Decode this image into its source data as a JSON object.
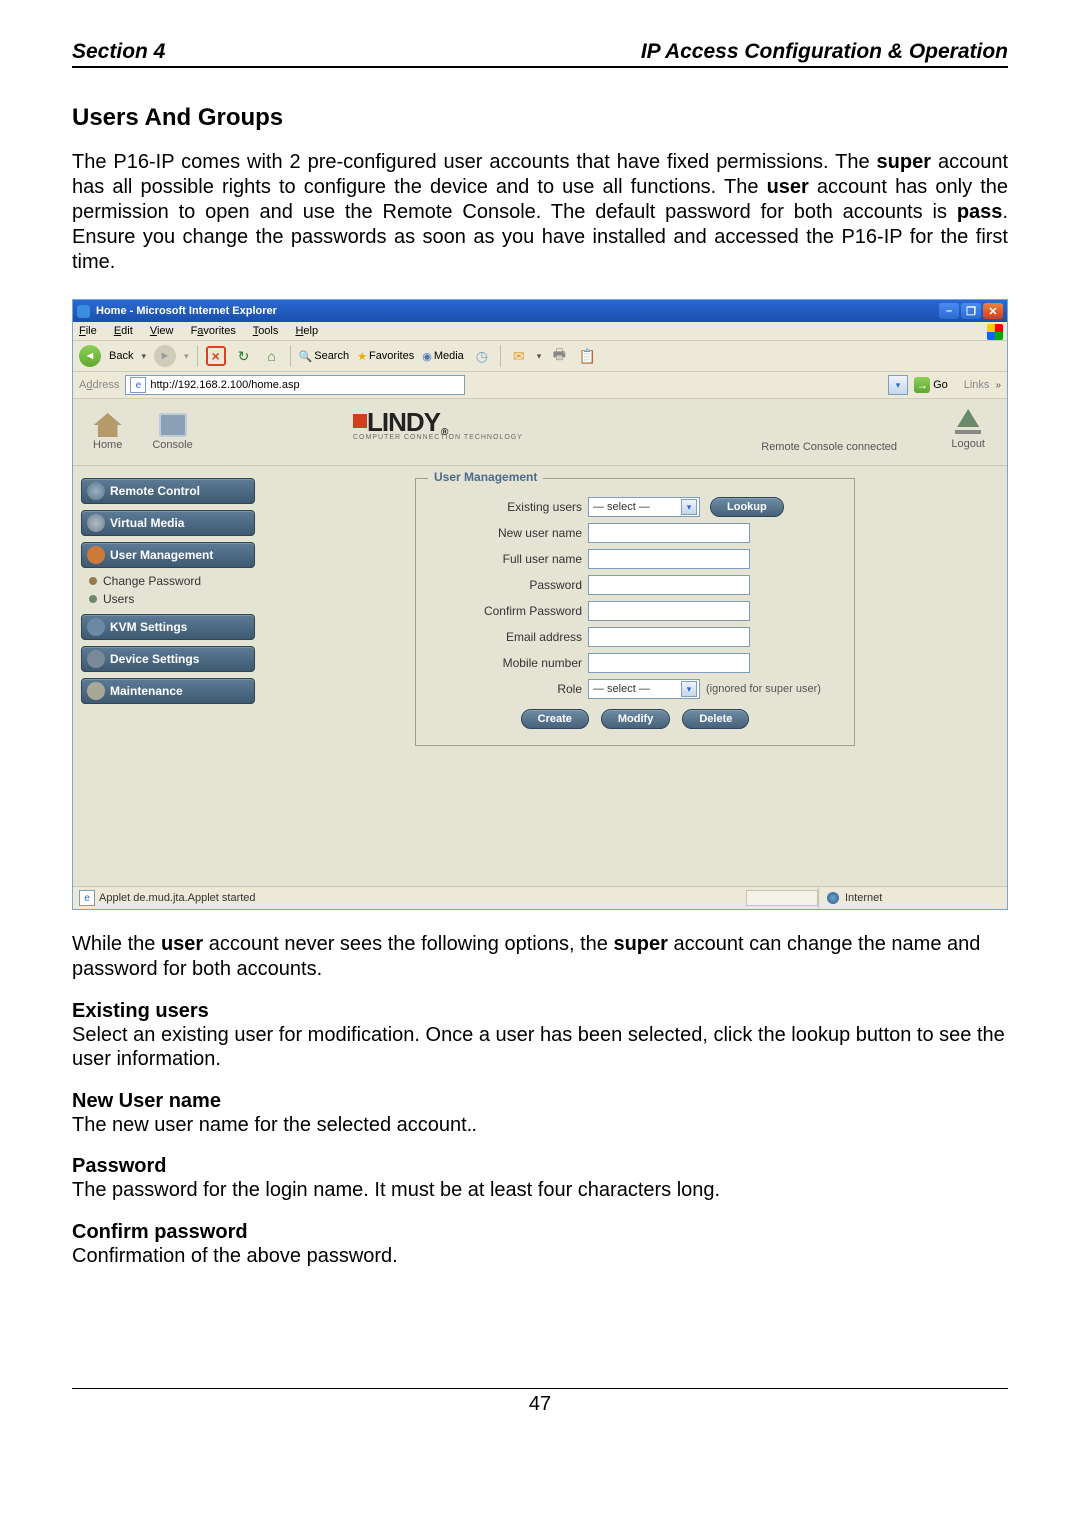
{
  "header": {
    "left": "Section 4",
    "right": "IP Access Configuration & Operation"
  },
  "title": "Users And Groups",
  "intro": {
    "p1a": "The P16-IP comes with 2 pre-configured user accounts that have fixed permissions. The ",
    "p1b": "super",
    "p1c": " account has all possible rights to configure the device and to use all functions. The ",
    "p1d": "user",
    "p1e": " account has only the permission to open and use the Remote Console. The default password for both accounts is ",
    "p1f": "pass",
    "p1g": ". Ensure you change the passwords as soon as you have installed and accessed the P16-IP for the first time."
  },
  "screenshot": {
    "titlebar": "Home - Microsoft Internet Explorer",
    "menus": {
      "file": "File",
      "edit": "Edit",
      "view": "View",
      "favorites": "Favorites",
      "tools": "Tools",
      "help": "Help"
    },
    "toolbar": {
      "back": "Back",
      "search": "Search",
      "favorites": "Favorites",
      "media": "Media"
    },
    "addressbar": {
      "label": "Address",
      "url": "http://192.168.2.100/home.asp",
      "go": "Go",
      "links": "Links"
    },
    "topnav": {
      "home": "Home",
      "console": "Console",
      "logout": "Logout"
    },
    "brand": {
      "name": "LINDY",
      "sub": "COMPUTER CONNECTION TECHNOLOGY",
      "reg": "®"
    },
    "status_text": "Remote Console connected",
    "sidebar": {
      "remote": "Remote Control",
      "virtual": "Virtual Media",
      "usermgmt": "User Management",
      "changepw": "Change Password",
      "users": "Users",
      "kvm": "KVM Settings",
      "device": "Device Settings",
      "maint": "Maintenance"
    },
    "form": {
      "legend": "User Management",
      "existing": "Existing users",
      "lookup": "Lookup",
      "newuser": "New user name",
      "fulluser": "Full user name",
      "password": "Password",
      "confirm": "Confirm Password",
      "email": "Email address",
      "mobile": "Mobile number",
      "role": "Role",
      "select": "— select —",
      "rolenote": "(ignored for super user)",
      "create": "Create",
      "modify": "Modify",
      "delete": "Delete"
    },
    "statusbar": {
      "left": "Applet de.mud.jta.Applet started",
      "right": "Internet"
    }
  },
  "after": {
    "p2a": "While the ",
    "p2b": "user",
    "p2c": " account never sees the following options, the ",
    "p2d": "super",
    "p2e": " account can change the name and password for both accounts."
  },
  "sections": {
    "existing": {
      "head": "Existing users",
      "text": "Select an existing user for modification. Once a user has been selected, click the lookup button to see the user information."
    },
    "newuser": {
      "head": "New User name",
      "text": "The new user name for the selected account."
    },
    "password": {
      "head": "Password",
      "text": "The password for the login name. It must be at least four characters long."
    },
    "confirm": {
      "head": "Confirm password",
      "text": "Confirmation of the above password."
    }
  },
  "pagenum": "47"
}
